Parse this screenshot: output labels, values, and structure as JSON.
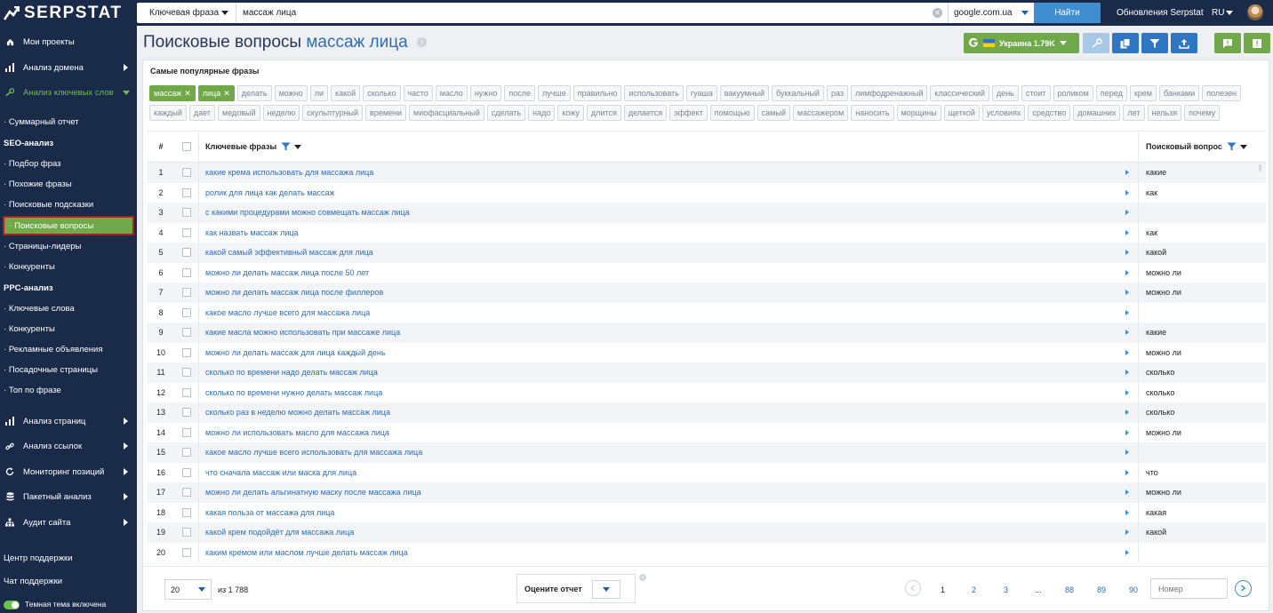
{
  "app": {
    "logo_text": "SERPSTAT"
  },
  "search": {
    "type_label": "Ключевая фраза",
    "query": "массаж лица",
    "database": "google.com.ua",
    "submit_label": "Найти"
  },
  "topnav": {
    "updates_label": "Обновления Serpstat",
    "lang": "RU"
  },
  "sidebar": {
    "main_items": [
      {
        "label": "Мои проекты"
      },
      {
        "label": "Анализ домена"
      },
      {
        "label": "Анализ ключевых слов"
      }
    ],
    "summary": "Суммарный отчет",
    "seo_section": "SEO-анализ",
    "seo_items": [
      "Подбор фраз",
      "Похожие фразы",
      "Поисковые подсказки",
      "Поисковые вопросы",
      "Страницы-лидеры",
      "Конкуренты"
    ],
    "ppc_section": "PPC-анализ",
    "ppc_items": [
      "Ключевые слова",
      "Конкуренты",
      "Рекламные объявления",
      "Посадочные страницы",
      "Топ по фразе"
    ],
    "bottom_items": [
      {
        "label": "Анализ страниц"
      },
      {
        "label": "Анализ ссылок"
      },
      {
        "label": "Мониторинг позиций"
      },
      {
        "label": "Пакетный анализ"
      },
      {
        "label": "Аудит сайта"
      }
    ],
    "support_center": "Центр поддержки",
    "support_chat": "Чат поддержки",
    "dark_theme": "Темная тема включена"
  },
  "page": {
    "title": "Поисковые вопросы",
    "query": "массаж лица",
    "region_label": "Украина 1.79K"
  },
  "colors": {
    "accent": "#3e8ed0",
    "brand_green": "#70a84a",
    "sidebar_bg": "#1a2b4a",
    "link": "#2e6db4"
  },
  "popular": {
    "title": "Самые популярные фразы",
    "row1": [
      {
        "t": "массаж",
        "sel": true
      },
      {
        "t": "лица",
        "sel": true
      },
      {
        "t": "делать"
      },
      {
        "t": "можно"
      },
      {
        "t": "ли"
      },
      {
        "t": "какой"
      },
      {
        "t": "сколько"
      },
      {
        "t": "часто"
      },
      {
        "t": "масло"
      },
      {
        "t": "нужно"
      },
      {
        "t": "после"
      },
      {
        "t": "лучше"
      },
      {
        "t": "правильно"
      },
      {
        "t": "использовать"
      },
      {
        "t": "гуаша"
      },
      {
        "t": "вакуумный"
      },
      {
        "t": "буккальный"
      },
      {
        "t": "раз"
      },
      {
        "t": "лимфодренажный"
      },
      {
        "t": "классический"
      },
      {
        "t": "день"
      },
      {
        "t": "стоит"
      },
      {
        "t": "роликом"
      },
      {
        "t": "перед"
      },
      {
        "t": "крем"
      },
      {
        "t": "банками"
      },
      {
        "t": "полезен"
      }
    ],
    "row2": [
      {
        "t": "каждый"
      },
      {
        "t": "дает"
      },
      {
        "t": "медовый"
      },
      {
        "t": "неделю"
      },
      {
        "t": "скульптурный"
      },
      {
        "t": "времени"
      },
      {
        "t": "миофасциальный"
      },
      {
        "t": "сделать"
      },
      {
        "t": "надо"
      },
      {
        "t": "кожу"
      },
      {
        "t": "длится"
      },
      {
        "t": "делается"
      },
      {
        "t": "эффект"
      },
      {
        "t": "помощью"
      },
      {
        "t": "самый"
      },
      {
        "t": "массажером"
      },
      {
        "t": "наносить"
      },
      {
        "t": "морщины"
      },
      {
        "t": "щеткой"
      },
      {
        "t": "условиях"
      },
      {
        "t": "средство"
      },
      {
        "t": "домашних"
      },
      {
        "t": "лет"
      },
      {
        "t": "нельзя"
      },
      {
        "t": "почему"
      }
    ]
  },
  "table": {
    "col_num": "#",
    "col_kw": "Ключевые фразы",
    "col_q": "Поисковый вопрос",
    "rows": [
      {
        "n": "1",
        "kw": "какие крема использовать для массажа лица",
        "q": "какие"
      },
      {
        "n": "2",
        "kw": "ролик для лица как делать массаж",
        "q": "как"
      },
      {
        "n": "3",
        "kw": "с какими процедурами можно совмещать массаж лица",
        "q": ""
      },
      {
        "n": "4",
        "kw": "как назвать массаж лица",
        "q": "как"
      },
      {
        "n": "5",
        "kw": "какой самый эффективный массаж для лица",
        "q": "какой"
      },
      {
        "n": "6",
        "kw": "можно ли делать массаж лица после 50 лет",
        "q": "можно ли"
      },
      {
        "n": "7",
        "kw": "можно ли делать массаж лица после филлеров",
        "q": "можно ли"
      },
      {
        "n": "8",
        "kw": "какое масло лучше всего для массажа лица",
        "q": ""
      },
      {
        "n": "9",
        "kw": "какие масла можно использовать при массаже лица",
        "q": "какие"
      },
      {
        "n": "10",
        "kw": "можно ли делать массаж для лица каждый день",
        "q": "можно ли"
      },
      {
        "n": "11",
        "kw": "сколько по времени надо делать массаж лица",
        "q": "сколько"
      },
      {
        "n": "12",
        "kw": "сколько по времени нужно делать массаж лица",
        "q": "сколько"
      },
      {
        "n": "13",
        "kw": "сколько раз в неделю можно делать массаж лица",
        "q": "сколько"
      },
      {
        "n": "14",
        "kw": "можно ли использовать масло для массажа лица",
        "q": "можно ли"
      },
      {
        "n": "15",
        "kw": "какое масло лучше всего использовать для массажа лица",
        "q": ""
      },
      {
        "n": "16",
        "kw": "что сначала массаж или маска для лица",
        "q": "что"
      },
      {
        "n": "17",
        "kw": "можно ли делать альгинатную маску после массажа лица",
        "q": "можно ли"
      },
      {
        "n": "18",
        "kw": "какая польза от массажа для лица",
        "q": "какая"
      },
      {
        "n": "19",
        "kw": "какой крем подойдёт для массажа лица",
        "q": "какой"
      },
      {
        "n": "20",
        "kw": "каким кремом или маслом лучше делать массаж лица",
        "q": ""
      }
    ]
  },
  "pagination": {
    "page_size": "20",
    "total": "из 1 788",
    "rate_label": "Оцените отчет",
    "pages": [
      "1",
      "2",
      "3",
      "...",
      "88",
      "89",
      "90"
    ],
    "page_input_placeholder": "Номер"
  }
}
